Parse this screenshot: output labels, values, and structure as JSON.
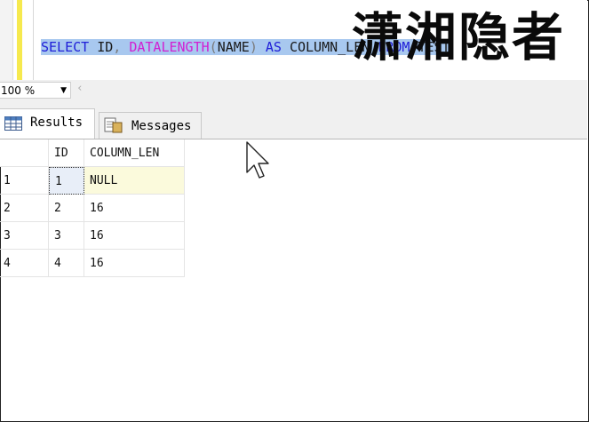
{
  "editor": {
    "sql_tokens": [
      {
        "text": "SELECT",
        "cls": "kw"
      },
      {
        "text": " ID",
        "cls": ""
      },
      {
        "text": ",",
        "cls": "gray"
      },
      {
        "text": " ",
        "cls": ""
      },
      {
        "text": "DATALENGTH",
        "cls": "fn"
      },
      {
        "text": "(",
        "cls": "gray"
      },
      {
        "text": "NAME",
        "cls": ""
      },
      {
        "text": ")",
        "cls": "gray"
      },
      {
        "text": " AS ",
        "cls": "kw"
      },
      {
        "text": "COLUMN_LEN ",
        "cls": ""
      },
      {
        "text": "FROM",
        "cls": "kw"
      },
      {
        "text": " TEST",
        "cls": ""
      }
    ],
    "watermark": "潇湘隐者"
  },
  "zoom": {
    "value": "100 %"
  },
  "tabs": [
    {
      "label": "Results",
      "icon": "grid-icon"
    },
    {
      "label": "Messages",
      "icon": "document-icon"
    }
  ],
  "results": {
    "columns": [
      "ID",
      "COLUMN_LEN"
    ],
    "rows": [
      {
        "num": "1",
        "id": "1",
        "len": "NULL"
      },
      {
        "num": "2",
        "id": "2",
        "len": "16"
      },
      {
        "num": "3",
        "id": "3",
        "len": "16"
      },
      {
        "num": "4",
        "id": "4",
        "len": "16"
      }
    ]
  }
}
